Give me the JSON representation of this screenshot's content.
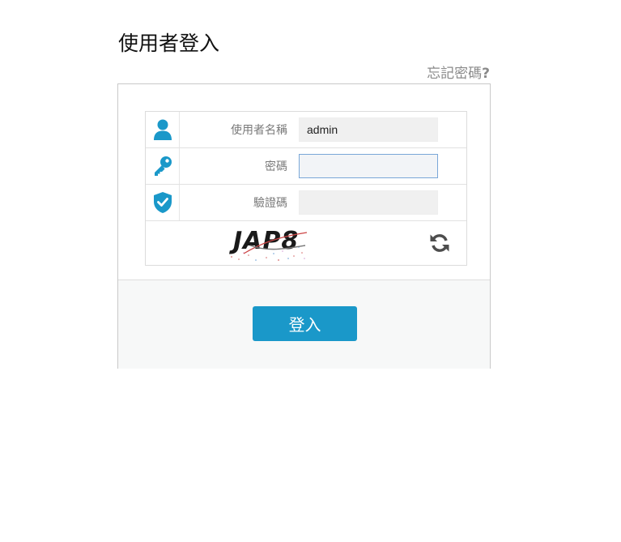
{
  "page": {
    "title": "使用者登入",
    "forgot_password_label": "忘記密碼",
    "forgot_password_mark": "?"
  },
  "form": {
    "username": {
      "label": "使用者名稱",
      "value": "admin",
      "icon": "user-icon"
    },
    "password": {
      "label": "密碼",
      "value": "",
      "icon": "key-icon"
    },
    "captcha": {
      "label": "驗證碼",
      "value": "",
      "icon": "shield-check-icon",
      "image_text": "JAP8",
      "refresh_icon": "refresh-icon"
    }
  },
  "actions": {
    "login_label": "登入"
  },
  "colors": {
    "accent": "#1a98c9",
    "label": "#7a7a7a",
    "field_bg": "#f0f0f0",
    "focus_border": "#7aa7d8"
  }
}
